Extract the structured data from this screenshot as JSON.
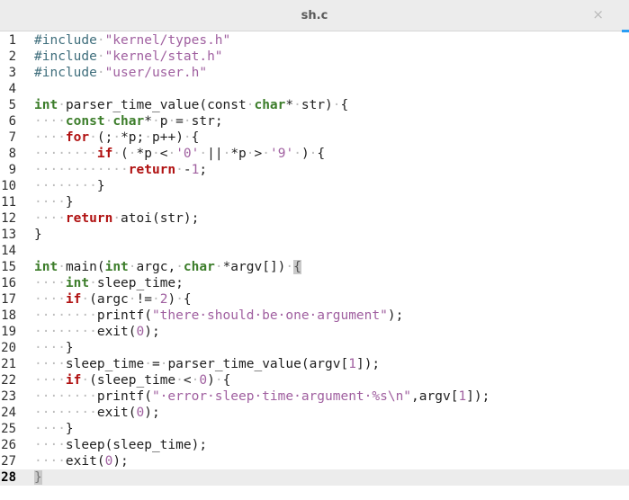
{
  "window": {
    "title": "sh.c",
    "close_glyph": "×"
  },
  "editor": {
    "current_line": 28,
    "lines": [
      [
        [
          "pre",
          "#include"
        ],
        [
          "ws",
          "·"
        ],
        [
          "str",
          "\"kernel/types.h\""
        ]
      ],
      [
        [
          "pre",
          "#include"
        ],
        [
          "ws",
          "·"
        ],
        [
          "str",
          "\"kernel/stat.h\""
        ]
      ],
      [
        [
          "pre",
          "#include"
        ],
        [
          "ws",
          "·"
        ],
        [
          "str",
          "\"user/user.h\""
        ]
      ],
      [],
      [
        [
          "kw",
          "int"
        ],
        [
          "ws",
          "·"
        ],
        [
          "id",
          "parser_time_value(const"
        ],
        [
          "ws",
          "·"
        ],
        [
          "kw",
          "char"
        ],
        [
          "id",
          "*"
        ],
        [
          "ws",
          "·"
        ],
        [
          "id",
          "str)"
        ],
        [
          "ws",
          "·"
        ],
        [
          "id",
          "{"
        ]
      ],
      [
        [
          "ws",
          "····"
        ],
        [
          "kw",
          "const"
        ],
        [
          "ws",
          "·"
        ],
        [
          "kw",
          "char"
        ],
        [
          "id",
          "*"
        ],
        [
          "ws",
          "·"
        ],
        [
          "id",
          "p"
        ],
        [
          "ws",
          "·"
        ],
        [
          "id",
          "="
        ],
        [
          "ws",
          "·"
        ],
        [
          "id",
          "str;"
        ]
      ],
      [
        [
          "ws",
          "····"
        ],
        [
          "flow",
          "for"
        ],
        [
          "ws",
          "·"
        ],
        [
          "id",
          "(;"
        ],
        [
          "ws",
          "·"
        ],
        [
          "id",
          "*p;"
        ],
        [
          "ws",
          "·"
        ],
        [
          "id",
          "p++)"
        ],
        [
          "ws",
          "·"
        ],
        [
          "id",
          "{"
        ]
      ],
      [
        [
          "ws",
          "········"
        ],
        [
          "flow",
          "if"
        ],
        [
          "ws",
          "·"
        ],
        [
          "id",
          "("
        ],
        [
          "ws",
          "·"
        ],
        [
          "id",
          "*p"
        ],
        [
          "ws",
          "·"
        ],
        [
          "id",
          "<"
        ],
        [
          "ws",
          "·"
        ],
        [
          "str",
          "'0'"
        ],
        [
          "ws",
          "·"
        ],
        [
          "id",
          "||"
        ],
        [
          "ws",
          "·"
        ],
        [
          "id",
          "*p"
        ],
        [
          "ws",
          "·"
        ],
        [
          "id",
          ">"
        ],
        [
          "ws",
          "·"
        ],
        [
          "str",
          "'9'"
        ],
        [
          "ws",
          "·"
        ],
        [
          "id",
          ")"
        ],
        [
          "ws",
          "·"
        ],
        [
          "id",
          "{"
        ]
      ],
      [
        [
          "ws",
          "············"
        ],
        [
          "flow",
          "return"
        ],
        [
          "ws",
          "·"
        ],
        [
          "id",
          "-"
        ],
        [
          "num",
          "1"
        ],
        [
          "id",
          ";"
        ]
      ],
      [
        [
          "ws",
          "········"
        ],
        [
          "id",
          "}"
        ]
      ],
      [
        [
          "ws",
          "····"
        ],
        [
          "id",
          "}"
        ]
      ],
      [
        [
          "ws",
          "····"
        ],
        [
          "flow",
          "return"
        ],
        [
          "ws",
          "·"
        ],
        [
          "id",
          "atoi(str);"
        ]
      ],
      [
        [
          "id",
          "}"
        ]
      ],
      [],
      [
        [
          "kw",
          "int"
        ],
        [
          "ws",
          "·"
        ],
        [
          "id",
          "main("
        ],
        [
          "kw",
          "int"
        ],
        [
          "ws",
          "·"
        ],
        [
          "id",
          "argc,"
        ],
        [
          "ws",
          "·"
        ],
        [
          "kw",
          "char"
        ],
        [
          "ws",
          "·"
        ],
        [
          "id",
          "*argv[])"
        ],
        [
          "ws",
          "·"
        ],
        [
          "bm",
          "{"
        ]
      ],
      [
        [
          "ws",
          "····"
        ],
        [
          "kw",
          "int"
        ],
        [
          "ws",
          "·"
        ],
        [
          "id",
          "sleep_time;"
        ]
      ],
      [
        [
          "ws",
          "····"
        ],
        [
          "flow",
          "if"
        ],
        [
          "ws",
          "·"
        ],
        [
          "id",
          "(argc"
        ],
        [
          "ws",
          "·"
        ],
        [
          "id",
          "!="
        ],
        [
          "ws",
          "·"
        ],
        [
          "num",
          "2"
        ],
        [
          "id",
          ")"
        ],
        [
          "ws",
          "·"
        ],
        [
          "id",
          "{"
        ]
      ],
      [
        [
          "ws",
          "········"
        ],
        [
          "id",
          "printf("
        ],
        [
          "str",
          "\"there·should·be·one·argument\""
        ],
        [
          "id",
          ");"
        ]
      ],
      [
        [
          "ws",
          "········"
        ],
        [
          "id",
          "exit("
        ],
        [
          "num",
          "0"
        ],
        [
          "id",
          ");"
        ]
      ],
      [
        [
          "ws",
          "····"
        ],
        [
          "id",
          "}"
        ]
      ],
      [
        [
          "ws",
          "····"
        ],
        [
          "id",
          "sleep_time"
        ],
        [
          "ws",
          "·"
        ],
        [
          "id",
          "="
        ],
        [
          "ws",
          "·"
        ],
        [
          "id",
          "parser_time_value(argv["
        ],
        [
          "num",
          "1"
        ],
        [
          "id",
          "]);"
        ]
      ],
      [
        [
          "ws",
          "····"
        ],
        [
          "flow",
          "if"
        ],
        [
          "ws",
          "·"
        ],
        [
          "id",
          "(sleep_time"
        ],
        [
          "ws",
          "·"
        ],
        [
          "id",
          "<"
        ],
        [
          "ws",
          "·"
        ],
        [
          "num",
          "0"
        ],
        [
          "id",
          ")"
        ],
        [
          "ws",
          "·"
        ],
        [
          "id",
          "{"
        ]
      ],
      [
        [
          "ws",
          "········"
        ],
        [
          "id",
          "printf("
        ],
        [
          "str",
          "\"·error·sleep·time·argument·%s\\n\""
        ],
        [
          "id",
          ",argv["
        ],
        [
          "num",
          "1"
        ],
        [
          "id",
          "]);"
        ]
      ],
      [
        [
          "ws",
          "········"
        ],
        [
          "id",
          "exit("
        ],
        [
          "num",
          "0"
        ],
        [
          "id",
          ");"
        ]
      ],
      [
        [
          "ws",
          "····"
        ],
        [
          "id",
          "}"
        ]
      ],
      [
        [
          "ws",
          "····"
        ],
        [
          "id",
          "sleep(sleep_time);"
        ]
      ],
      [
        [
          "ws",
          "····"
        ],
        [
          "id",
          "exit("
        ],
        [
          "num",
          "0"
        ],
        [
          "id",
          ");"
        ]
      ],
      [
        [
          "cur",
          "}"
        ]
      ]
    ]
  }
}
